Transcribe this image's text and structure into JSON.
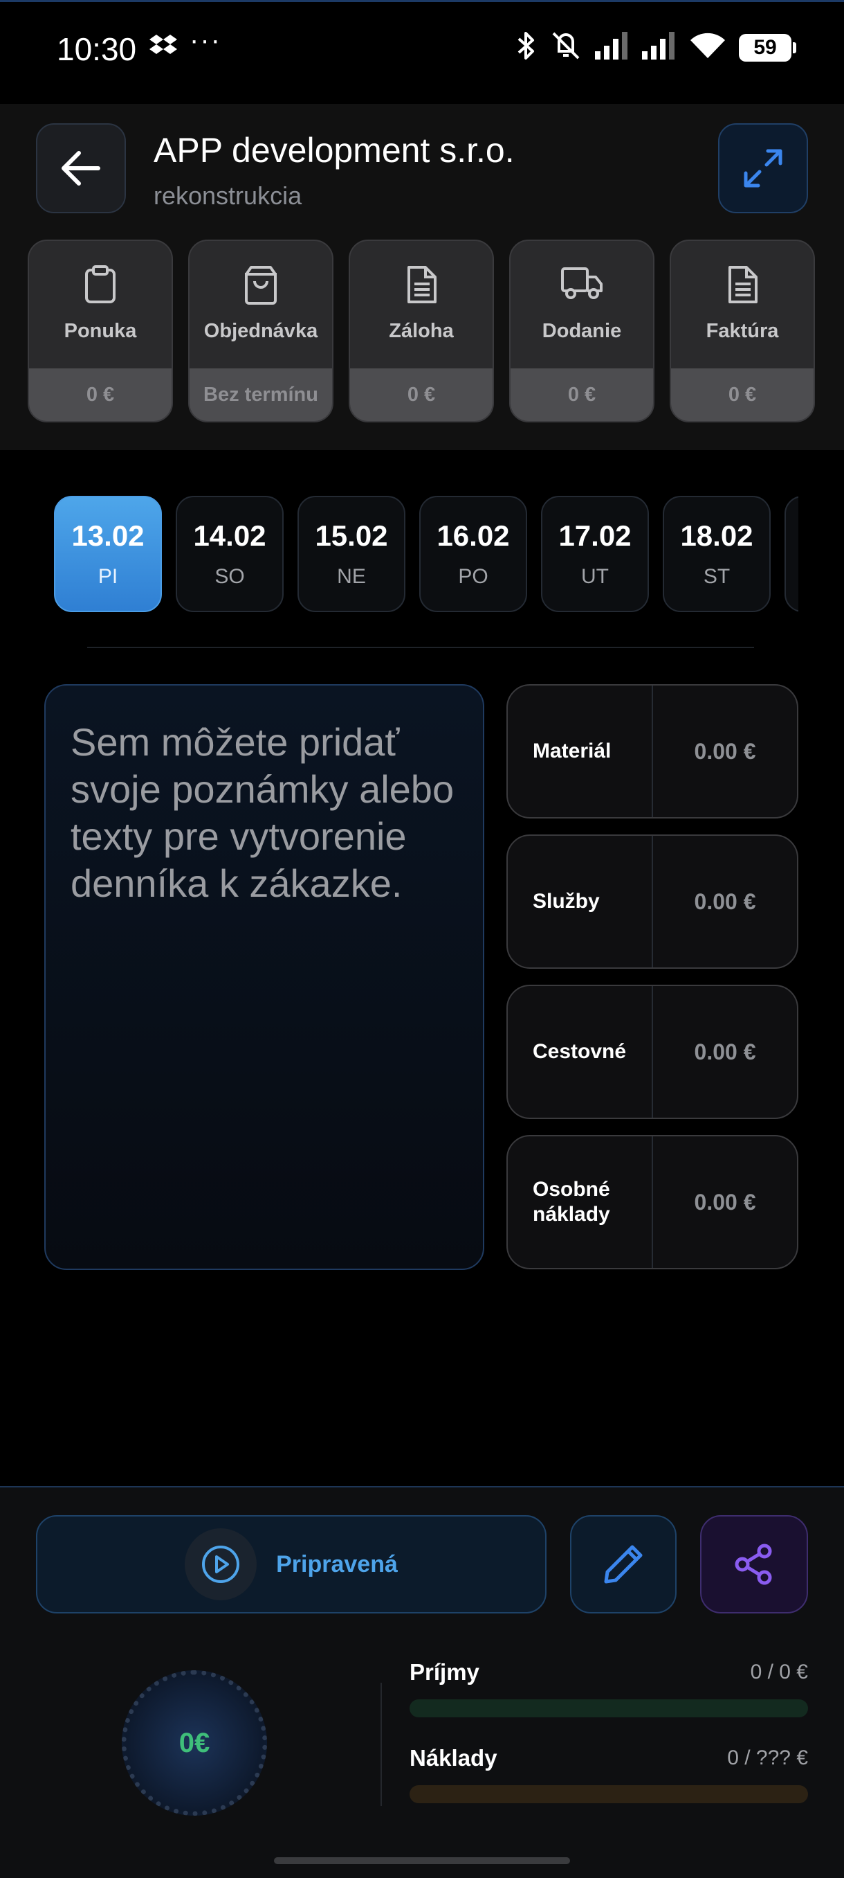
{
  "status_bar": {
    "time": "10:30",
    "dots": "···",
    "battery": "59",
    "icons": [
      "dropbox-icon",
      "bluetooth-icon",
      "mute-vibrate-icon",
      "signal-icon",
      "signal-icon",
      "wifi-icon",
      "battery-icon"
    ]
  },
  "header": {
    "title": "APP development s.r.o.",
    "subtitle": "rekonstrukcia"
  },
  "documents": [
    {
      "label": "Ponuka",
      "value": "0 €",
      "icon": "clipboard-icon"
    },
    {
      "label": "Objednávka",
      "value": "Bez termínu",
      "icon": "shopping-bag-icon"
    },
    {
      "label": "Záloha",
      "value": "0 €",
      "icon": "document-icon"
    },
    {
      "label": "Dodanie",
      "value": "0 €",
      "icon": "truck-icon"
    },
    {
      "label": "Faktúra",
      "value": "0 €",
      "icon": "document-icon"
    }
  ],
  "dates": [
    {
      "date": "13.02",
      "day": "PI",
      "active": true
    },
    {
      "date": "14.02",
      "day": "SO"
    },
    {
      "date": "15.02",
      "day": "NE"
    },
    {
      "date": "16.02",
      "day": "PO"
    },
    {
      "date": "17.02",
      "day": "UT"
    },
    {
      "date": "18.02",
      "day": "ST"
    },
    {
      "date": "",
      "day": ""
    }
  ],
  "notes": {
    "placeholder": "Sem môžete pridať svoje poznámky alebo texty pre vytvorenie denníka k zákazke."
  },
  "costs": [
    {
      "label": "Materiál",
      "value": "0.00 €"
    },
    {
      "label": "Služby",
      "value": "0.00 €"
    },
    {
      "label": "Cestovné",
      "value": "0.00 €"
    },
    {
      "label": "Osobné náklady",
      "value": "0.00 €"
    }
  ],
  "actions": {
    "status_label": "Pripravená"
  },
  "summary": {
    "balance": "0€",
    "income_label": "Príjmy",
    "income_value": "0 / 0 €",
    "expense_label": "Náklady",
    "expense_value": "0 / ??? €"
  },
  "colors": {
    "accent": "#4ea4ea",
    "share": "#8a5cf0",
    "balance_green": "#3fbf7a"
  }
}
